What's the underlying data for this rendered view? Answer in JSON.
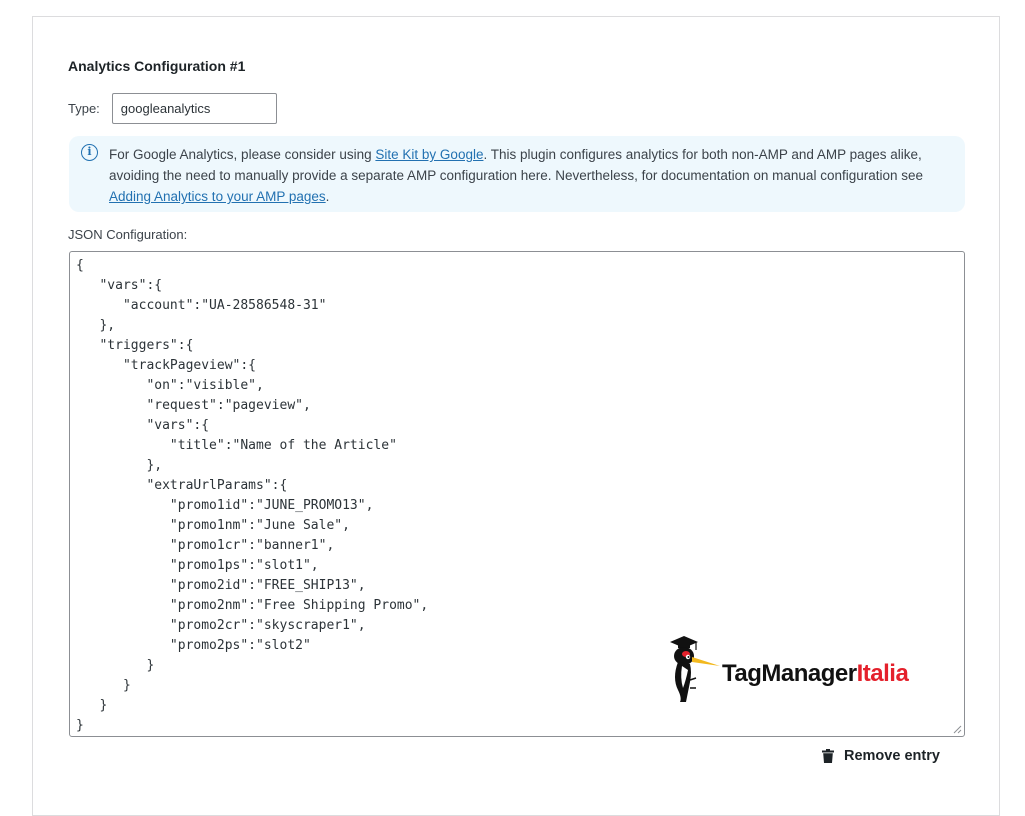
{
  "section": {
    "title": "Analytics Configuration #1"
  },
  "type_field": {
    "label": "Type:",
    "value": "googleanalytics"
  },
  "notice": {
    "icon": "info-icon",
    "text_before_link1": "For Google Analytics, please consider using ",
    "link1": "Site Kit by Google",
    "text_middle": ". This plugin configures analytics for both non-AMP and AMP pages alike, avoiding the need to manually provide a separate AMP configuration here. Nevertheless, for documentation on manual configuration see ",
    "link2": "Adding Analytics to your AMP pages",
    "text_after": ".",
    "link_color": "#2271b1",
    "background": "#eef8fd"
  },
  "json_config": {
    "label": "JSON Configuration:",
    "content": "{\n   \"vars\":{\n      \"account\":\"UA-28586548-31\"\n   },\n   \"triggers\":{\n      \"trackPageview\":{\n         \"on\":\"visible\",\n         \"request\":\"pageview\",\n         \"vars\":{\n            \"title\":\"Name of the Article\"\n         },\n         \"extraUrlParams\":{\n            \"promo1id\":\"JUNE_PROMO13\",\n            \"promo1nm\":\"June Sale\",\n            \"promo1cr\":\"banner1\",\n            \"promo1ps\":\"slot1\",\n            \"promo2id\":\"FREE_SHIP13\",\n            \"promo2nm\":\"Free Shipping Promo\",\n            \"promo2cr\":\"skyscraper1\",\n            \"promo2ps\":\"slot2\"\n         }\n      }\n   }\n}"
  },
  "watermark": {
    "text_dark": "TagManager",
    "text_accent": "Italia",
    "accent_color": "#e4202b"
  },
  "actions": {
    "remove_label": "Remove entry",
    "remove_icon": "trash-icon"
  }
}
